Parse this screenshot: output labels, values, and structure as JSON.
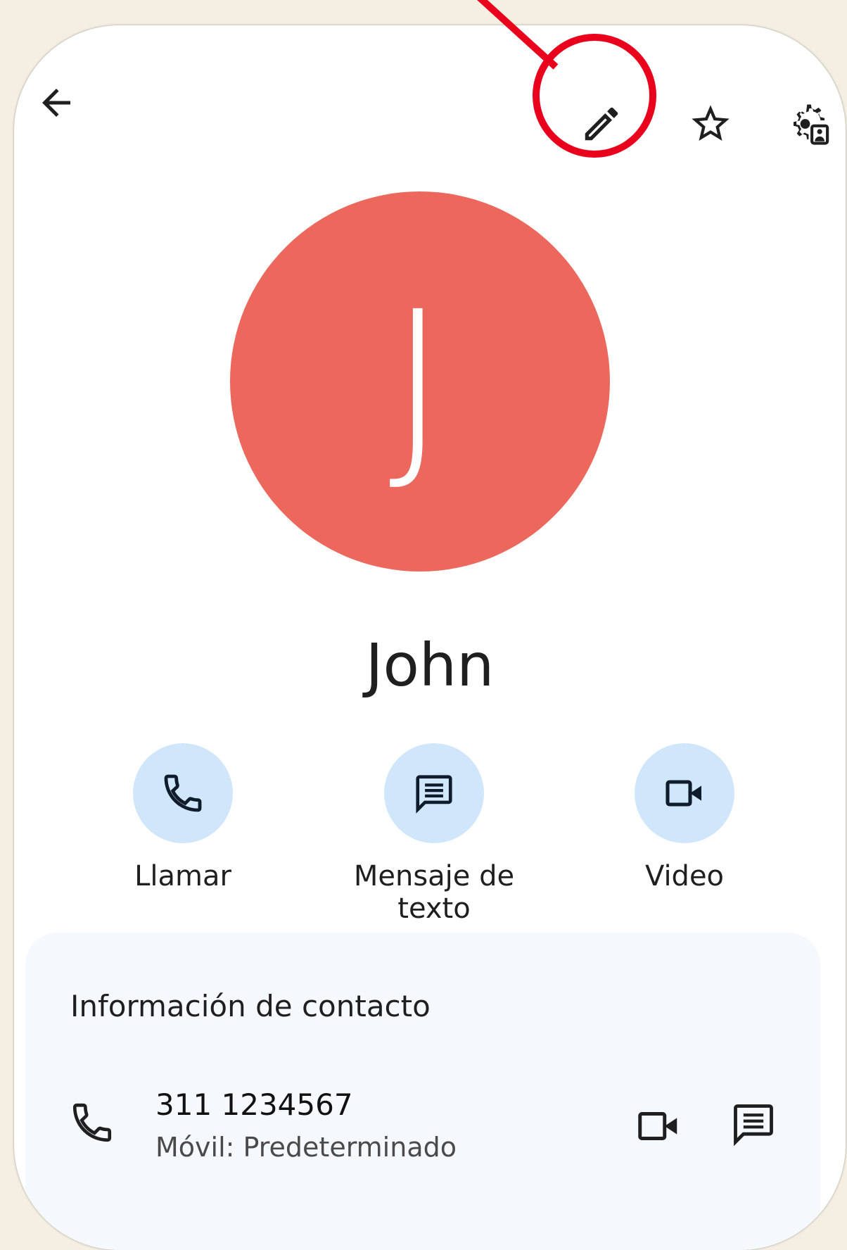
{
  "header": {
    "back_icon": "arrow-left-icon",
    "edit_icon": "pencil-icon",
    "favorite_icon": "star-outline-icon",
    "settings_icon": "contact-settings-icon"
  },
  "contact": {
    "initial": "J",
    "name": "John",
    "avatar_color": "#ec685d"
  },
  "actions": [
    {
      "label": "Llamar",
      "icon": "phone-icon"
    },
    {
      "label": "Mensaje de texto",
      "icon": "message-icon"
    },
    {
      "label": "Video",
      "icon": "video-icon"
    }
  ],
  "info_card": {
    "title": "Información de contacto",
    "phone": {
      "number": "311 1234567",
      "type": "Móvil: Predeterminado"
    }
  },
  "colors": {
    "action_circle": "#cfe6fb",
    "annotation": "#e8001c",
    "card_bg": "#f5f8fc"
  }
}
